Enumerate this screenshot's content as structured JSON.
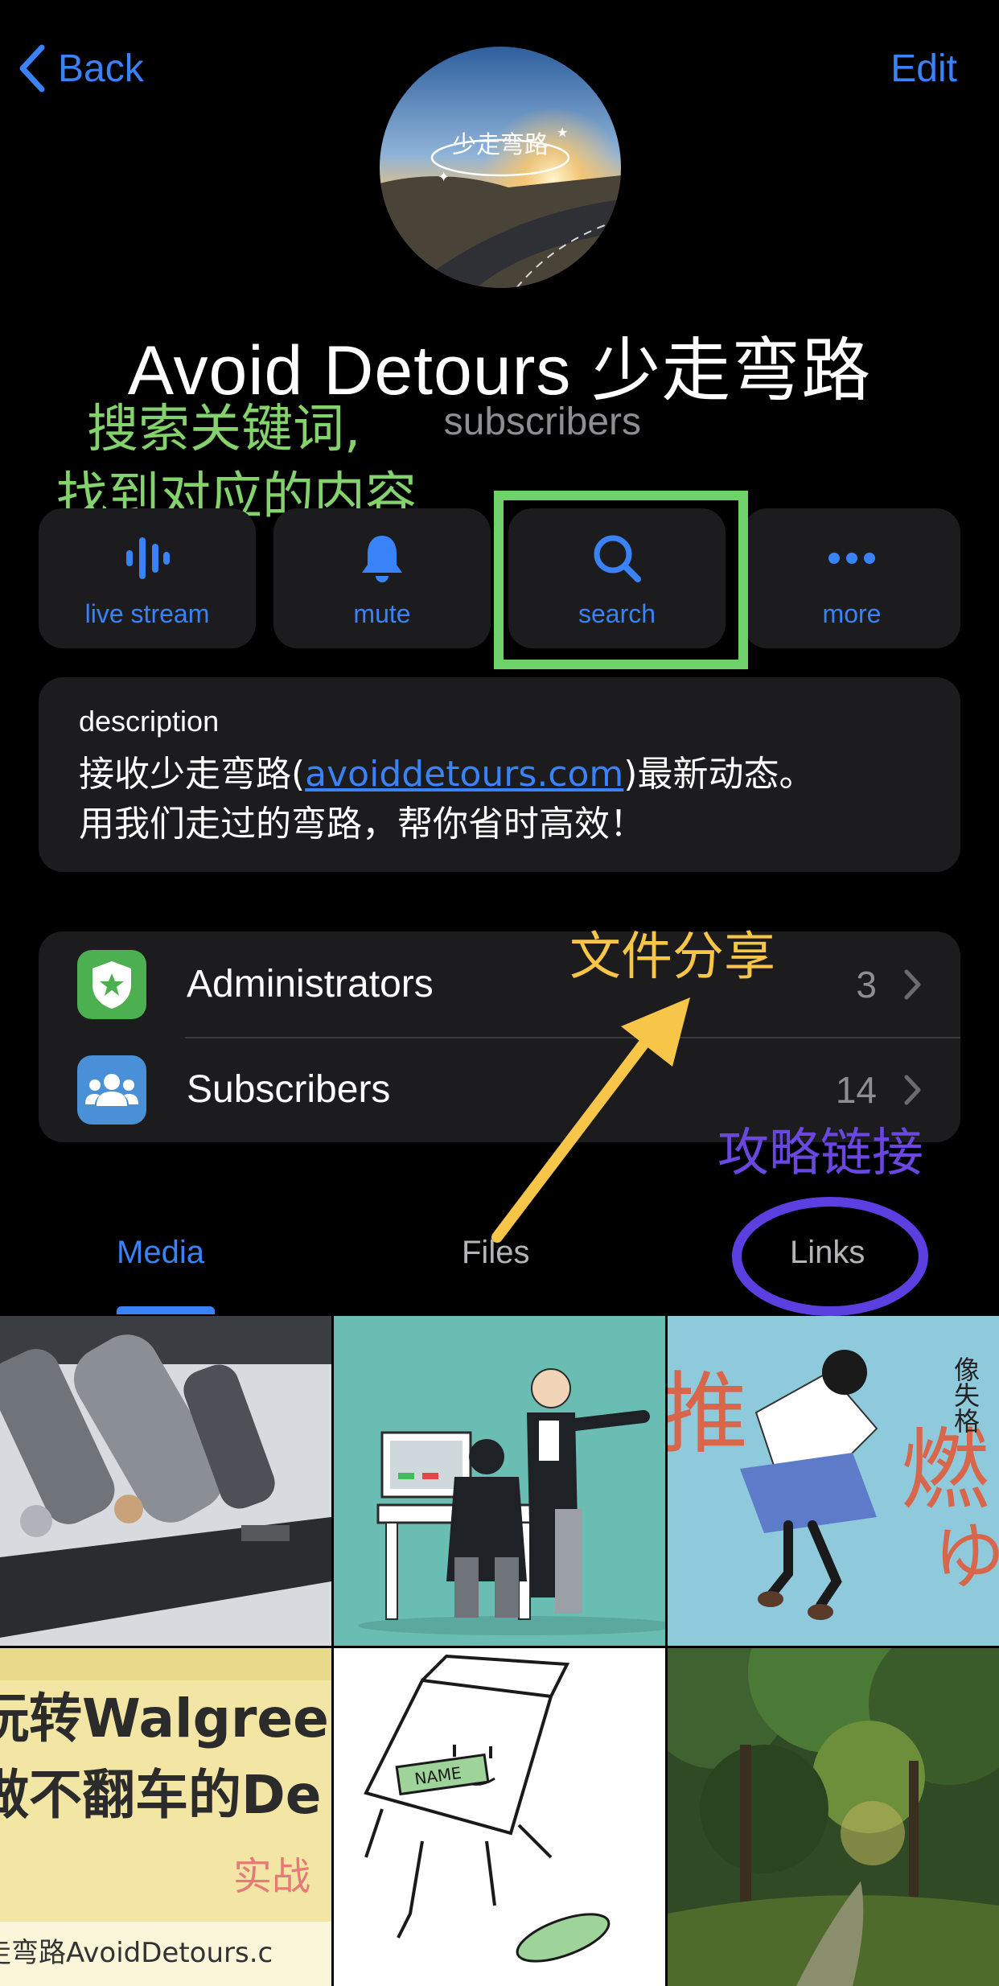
{
  "nav": {
    "back_label": "Back",
    "edit_label": "Edit"
  },
  "channel": {
    "title": "Avoid Detours 少走弯路",
    "subscribers_text": "subscribers"
  },
  "actions": [
    {
      "label": "live stream",
      "icon": "live-stream-icon"
    },
    {
      "label": "mute",
      "icon": "bell-icon"
    },
    {
      "label": "search",
      "icon": "search-icon"
    },
    {
      "label": "more",
      "icon": "more-dots-icon"
    }
  ],
  "description": {
    "label": "description",
    "line1_prefix": "接收少走弯路(",
    "link": "avoiddetours.com",
    "line1_suffix": ")最新动态。",
    "line2": "用我们走过的弯路，帮你省时高效！"
  },
  "list": [
    {
      "label": "Administrators",
      "count": "3",
      "icon": "admin-badge-icon",
      "color": "#4caf50"
    },
    {
      "label": "Subscribers",
      "count": "14",
      "icon": "people-icon",
      "color": "#4a90d9"
    }
  ],
  "annotations": {
    "search_hint_line1": "搜索关键词,",
    "search_hint_line2": "找到对应的内容",
    "files_hint": "文件分享",
    "links_hint": "攻略链接",
    "green": "#6fd16a",
    "yellow": "#f7c548",
    "purple": "#5b3fe0"
  },
  "tabs": {
    "media": "Media",
    "files": "Files",
    "links": "Links"
  },
  "media_thumbs": {
    "walgreens_line1": "玩转Walgreen",
    "walgreens_line2": "做不翻车的De",
    "walgreens_line3": "实战",
    "walgreens_footer": "走弯路AvoidDetours.c",
    "book_char1": "推",
    "book_char2": "燃",
    "book_char3": "ゆ",
    "book_author": "像失格",
    "name_tag": "NAME"
  },
  "colors": {
    "accent": "#3a82f7",
    "card": "#1c1c1e",
    "secondary_text": "#8e8e93"
  }
}
